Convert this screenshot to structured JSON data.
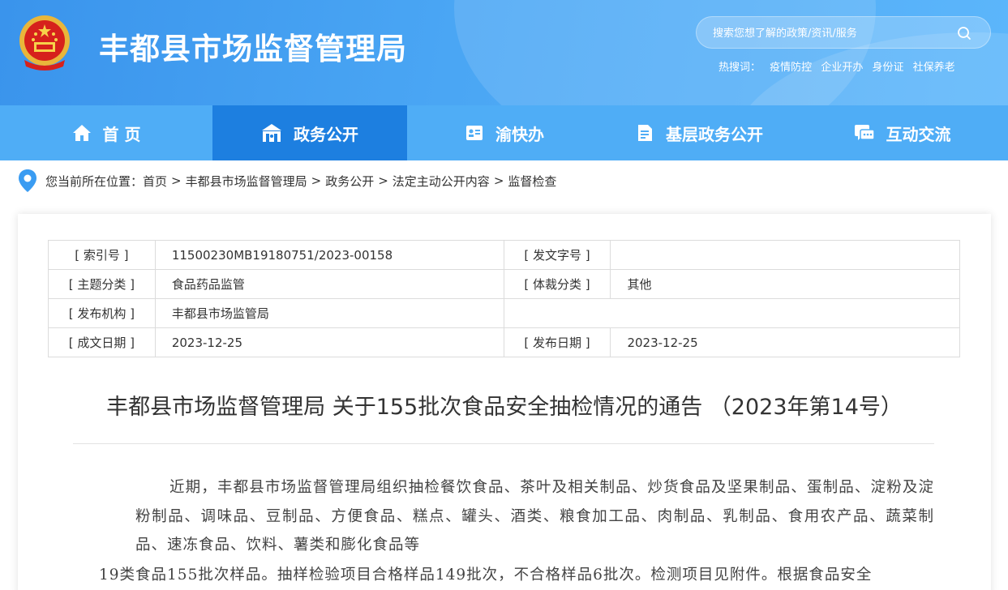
{
  "header": {
    "site_title": "丰都县市场监督管理局",
    "search_placeholder": "搜索您想了解的政策/资讯/服务",
    "hot_label": "热搜词：",
    "hot_words": [
      "疫情防控",
      "企业开办",
      "身份证",
      "社保养老"
    ]
  },
  "nav": {
    "items": [
      {
        "label": "首 页",
        "icon": "home-icon"
      },
      {
        "label": "政务公开",
        "icon": "government-building-icon",
        "active": true
      },
      {
        "label": "渝快办",
        "icon": "id-card-icon"
      },
      {
        "label": "基层政务公开",
        "icon": "document-icon"
      },
      {
        "label": "互动交流",
        "icon": "chat-icon"
      }
    ]
  },
  "breadcrumb": {
    "prefix": "您当前所在位置：",
    "items": [
      "首页",
      "丰都县市场监督管理局",
      "政务公开",
      "法定主动公开内容",
      "监督检查"
    ],
    "separator": ">"
  },
  "meta": {
    "index_label": "[ 索引号 ]",
    "index_value": "11500230MB19180751/2023-00158",
    "doc_no_label": "[ 发文字号 ]",
    "doc_no_value": "",
    "topic_label": "[ 主题分类 ]",
    "topic_value": "食品药品监管",
    "genre_label": "[ 体裁分类 ]",
    "genre_value": "其他",
    "org_label": "[ 发布机构 ]",
    "org_value": "丰都县市场监管局",
    "written_label": "[ 成文日期 ]",
    "written_value": "2023-12-25",
    "publish_label": "[ 发布日期 ]",
    "publish_value": "2023-12-25"
  },
  "article": {
    "title": "丰都县市场监督管理局 关于155批次食品安全抽检情况的通告 （2023年第14号）",
    "para1": "近期，丰都县市场监督管理局组织抽检餐饮食品、茶叶及相关制品、炒货食品及坚果制品、蛋制品、淀粉及淀粉制品、调味品、豆制品、方便食品、糕点、罐头、酒类、粮食加工品、肉制品、乳制品、食用农产品、蔬菜制品、速冻食品、饮料、薯类和膨化食品等",
    "para2": "19类食品155批次样品。抽样检验项目合格样品149批次，不合格样品6批次。检测项目见附件。根据食品安全"
  },
  "colors": {
    "header_bg": "#4aa6f4",
    "nav_bg": "#4fadf6",
    "nav_active": "#1d7fe0",
    "pin": "#3a9cf2"
  }
}
